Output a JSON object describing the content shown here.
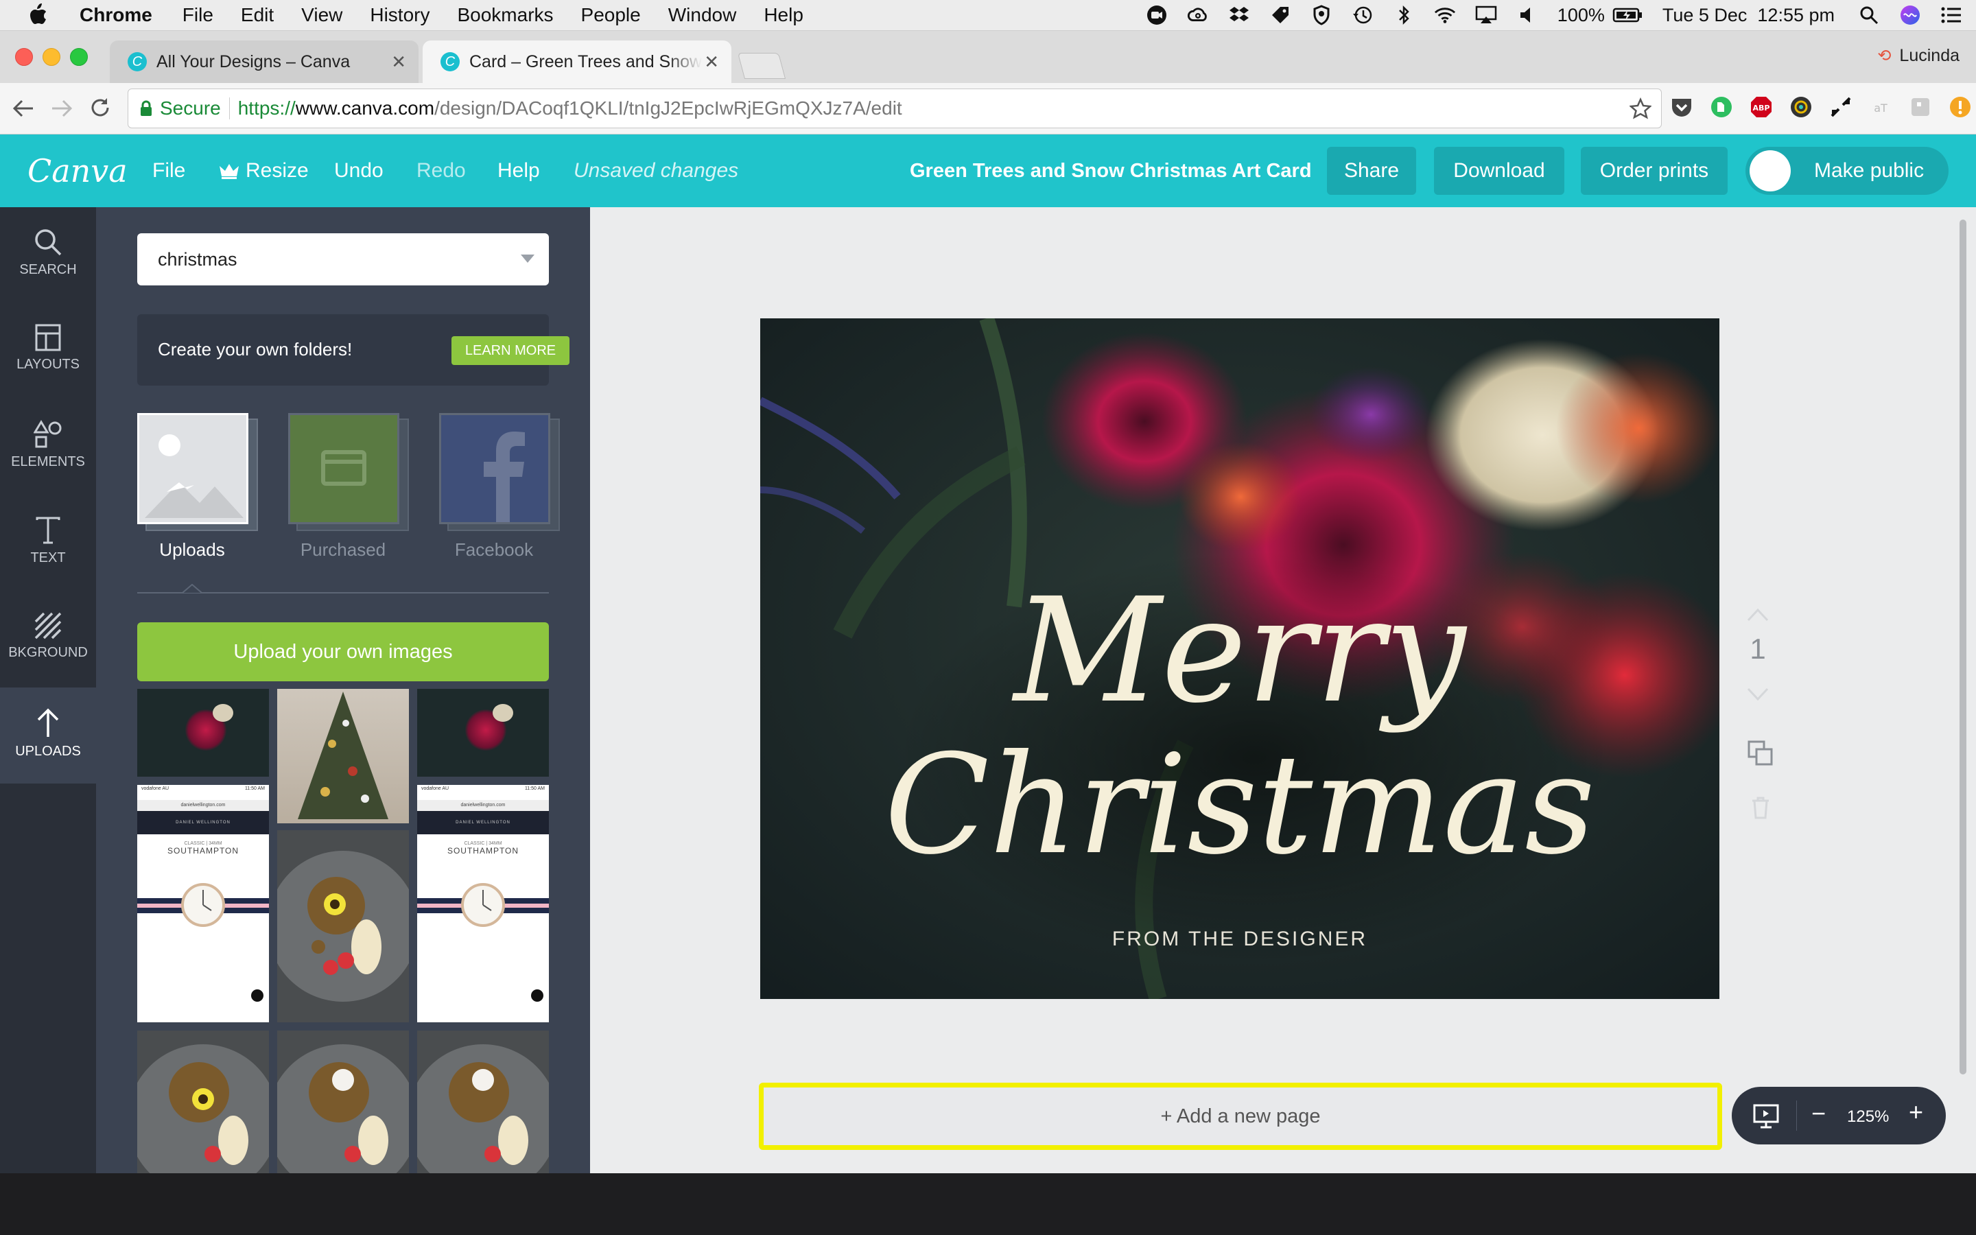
{
  "menubar": {
    "app": "Chrome",
    "items": [
      "File",
      "Edit",
      "View",
      "History",
      "Bookmarks",
      "People",
      "Window",
      "Help"
    ],
    "battery": "100%",
    "datetime": "Tue 5 Dec  12:55 pm"
  },
  "tabs": [
    {
      "title": "All Your Designs – Canva",
      "favicon": "C"
    },
    {
      "title": "Card – Green Trees and Snow",
      "favicon": "C"
    }
  ],
  "profile": "Lucinda",
  "address": {
    "secure_label": "Secure",
    "scheme": "https://",
    "host": "www.canva.com",
    "path": "/design/DACoqf1QKLI/tnIgJ2EpcIwRjEGmQXJz7A/edit"
  },
  "canva": {
    "logo": "Canva",
    "nav": {
      "file": "File",
      "resize": "Resize",
      "undo": "Undo",
      "redo": "Redo",
      "help": "Help"
    },
    "status": "Unsaved changes",
    "design_title": "Green Trees and Snow Christmas Art Card",
    "buttons": {
      "share": "Share",
      "download": "Download",
      "order_prints": "Order prints",
      "make_public": "Make public"
    },
    "colors": {
      "brand": "#20c4cb",
      "button": "#1aa9b0",
      "green": "#8dc63f",
      "highlight": "#f2f000"
    }
  },
  "sidebar": {
    "items": [
      {
        "label": "SEARCH",
        "icon": "search-icon"
      },
      {
        "label": "LAYOUTS",
        "icon": "layouts-icon"
      },
      {
        "label": "ELEMENTS",
        "icon": "elements-icon"
      },
      {
        "label": "TEXT",
        "icon": "text-icon"
      },
      {
        "label": "BKGROUND",
        "icon": "background-icon"
      },
      {
        "label": "UPLOADS",
        "icon": "upload-arrow-icon"
      }
    ],
    "active": "UPLOADS"
  },
  "panel": {
    "folder_select": "christmas",
    "promo": {
      "text": "Create your own folders!",
      "button": "LEARN MORE"
    },
    "sources": [
      {
        "label": "Uploads",
        "active": true
      },
      {
        "label": "Purchased",
        "active": false
      },
      {
        "label": "Facebook",
        "active": false
      }
    ],
    "upload_button": "Upload your own images",
    "thumb_text": {
      "brand": "DANIEL WELLINGTON",
      "series": "CLASSIC | 34MM",
      "model": "SOUTHAMPTON",
      "url": "danielwellington.com",
      "carrier": "vodafone AU",
      "time": "11:50 AM"
    }
  },
  "card": {
    "line1": "Merry",
    "line2": "Christmas",
    "subtitle": "FROM THE DESIGNER"
  },
  "page_tools": {
    "page_number": "1"
  },
  "add_page": "+ Add a new page",
  "zoom": {
    "level": "125%",
    "minus": "−",
    "plus": "+"
  }
}
